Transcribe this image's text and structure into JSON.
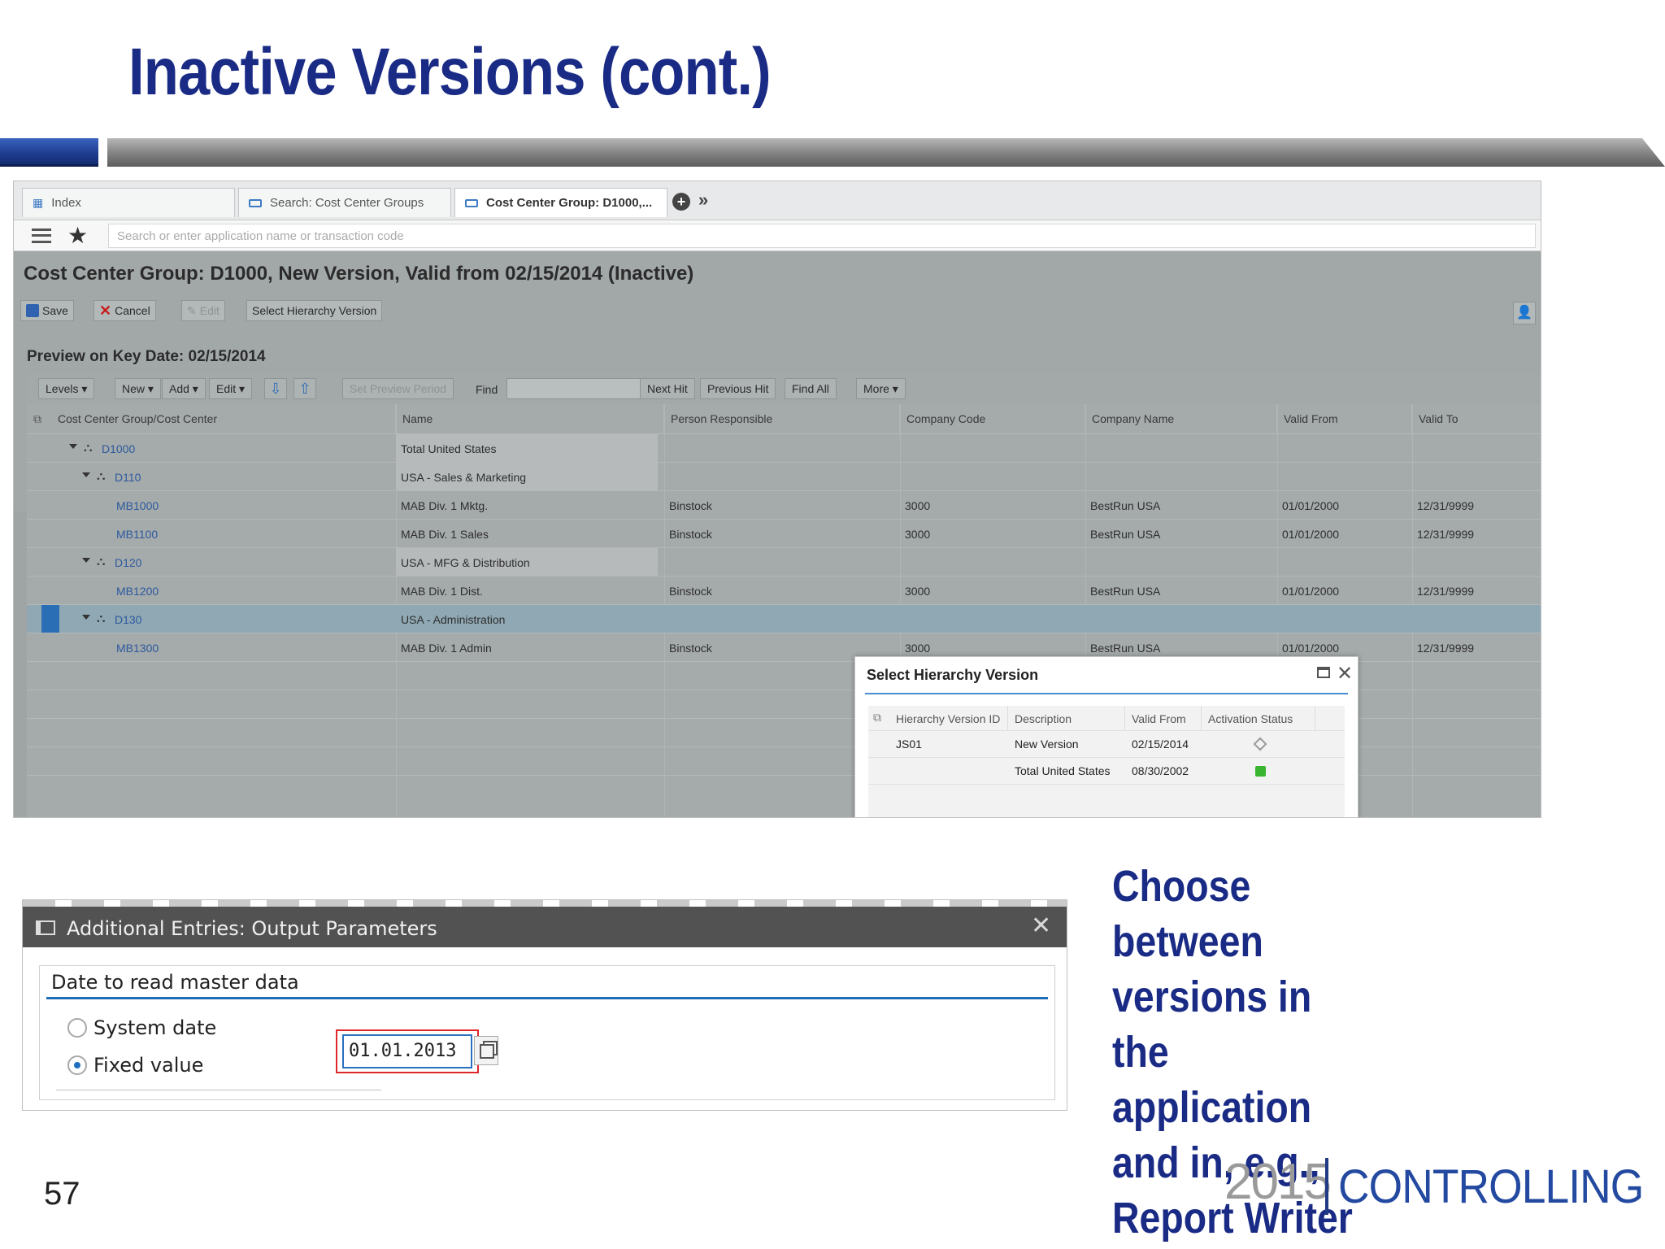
{
  "slide": {
    "title": "Inactive Versions (cont.)",
    "caption": "Choose between versions in the application and in, e.g., Report Writer",
    "page_number": "57",
    "logo_year": "2015",
    "logo_word": "CONTROLLING"
  },
  "app": {
    "tabs": [
      {
        "label": "Index",
        "active": false
      },
      {
        "label": "Search: Cost Center Groups",
        "active": false
      },
      {
        "label": "Cost Center Group: D1000,...",
        "active": true
      }
    ],
    "command_placeholder": "Search or enter application name or transaction code",
    "page_title": "Cost Center Group: D1000, New Version, Valid from 02/15/2014 (Inactive)",
    "toolbar": {
      "save": "Save",
      "cancel": "Cancel",
      "edit": "Edit",
      "select_version": "Select Hierarchy Version"
    },
    "preview_title": "Preview on Key Date: 02/15/2014",
    "grid_toolbar": {
      "levels": "Levels",
      "new": "New",
      "add": "Add",
      "edit": "Edit",
      "set_preview_period": "Set Preview Period",
      "find": "Find",
      "next_hit": "Next Hit",
      "previous_hit": "Previous Hit",
      "find_all": "Find All",
      "more": "More"
    },
    "columns": [
      "Cost Center Group/Cost Center",
      "Name",
      "Person Responsible",
      "Company Code",
      "Company Name",
      "Valid From",
      "Valid To"
    ],
    "rows": [
      {
        "id": "D1000",
        "name": "Total United States",
        "person": "",
        "code": "",
        "company": "",
        "from": "",
        "to": ""
      },
      {
        "id": "D110",
        "name": "USA - Sales & Marketing",
        "person": "",
        "code": "",
        "company": "",
        "from": "",
        "to": ""
      },
      {
        "id": "MB1000",
        "name": "MAB Div. 1 Mktg.",
        "person": "Binstock",
        "code": "3000",
        "company": "BestRun USA",
        "from": "01/01/2000",
        "to": "12/31/9999"
      },
      {
        "id": "MB1100",
        "name": "MAB Div. 1 Sales",
        "person": "Binstock",
        "code": "3000",
        "company": "BestRun USA",
        "from": "01/01/2000",
        "to": "12/31/9999"
      },
      {
        "id": "D120",
        "name": "USA - MFG & Distribution",
        "person": "",
        "code": "",
        "company": "",
        "from": "",
        "to": ""
      },
      {
        "id": "MB1200",
        "name": "MAB Div. 1 Dist.",
        "person": "Binstock",
        "code": "3000",
        "company": "BestRun USA",
        "from": "01/01/2000",
        "to": "12/31/9999"
      },
      {
        "id": "D130",
        "name": "USA - Administration",
        "person": "",
        "code": "",
        "company": "",
        "from": "",
        "to": ""
      },
      {
        "id": "MB1300",
        "name": "MAB Div. 1 Admin",
        "person": "Binstock",
        "code": "3000",
        "company": "BestRun USA",
        "from": "01/01/2000",
        "to": "12/31/9999"
      }
    ],
    "popup": {
      "title": "Select Hierarchy Version",
      "columns": [
        "Hierarchy Version ID",
        "Description",
        "Valid From",
        "Activation Status"
      ],
      "rows": [
        {
          "id": "JS01",
          "description": "New Version",
          "valid_from": "02/15/2014",
          "status": "inactive"
        },
        {
          "id": "",
          "description": "Total United States",
          "valid_from": "08/30/2002",
          "status": "active"
        }
      ]
    }
  },
  "dialog": {
    "title": "Additional Entries: Output Parameters",
    "group_title": "Date to read master data",
    "option_system": "System date",
    "option_fixed": "Fixed value",
    "fixed_value": "01.01.2013",
    "selected_option": "Fixed value"
  }
}
